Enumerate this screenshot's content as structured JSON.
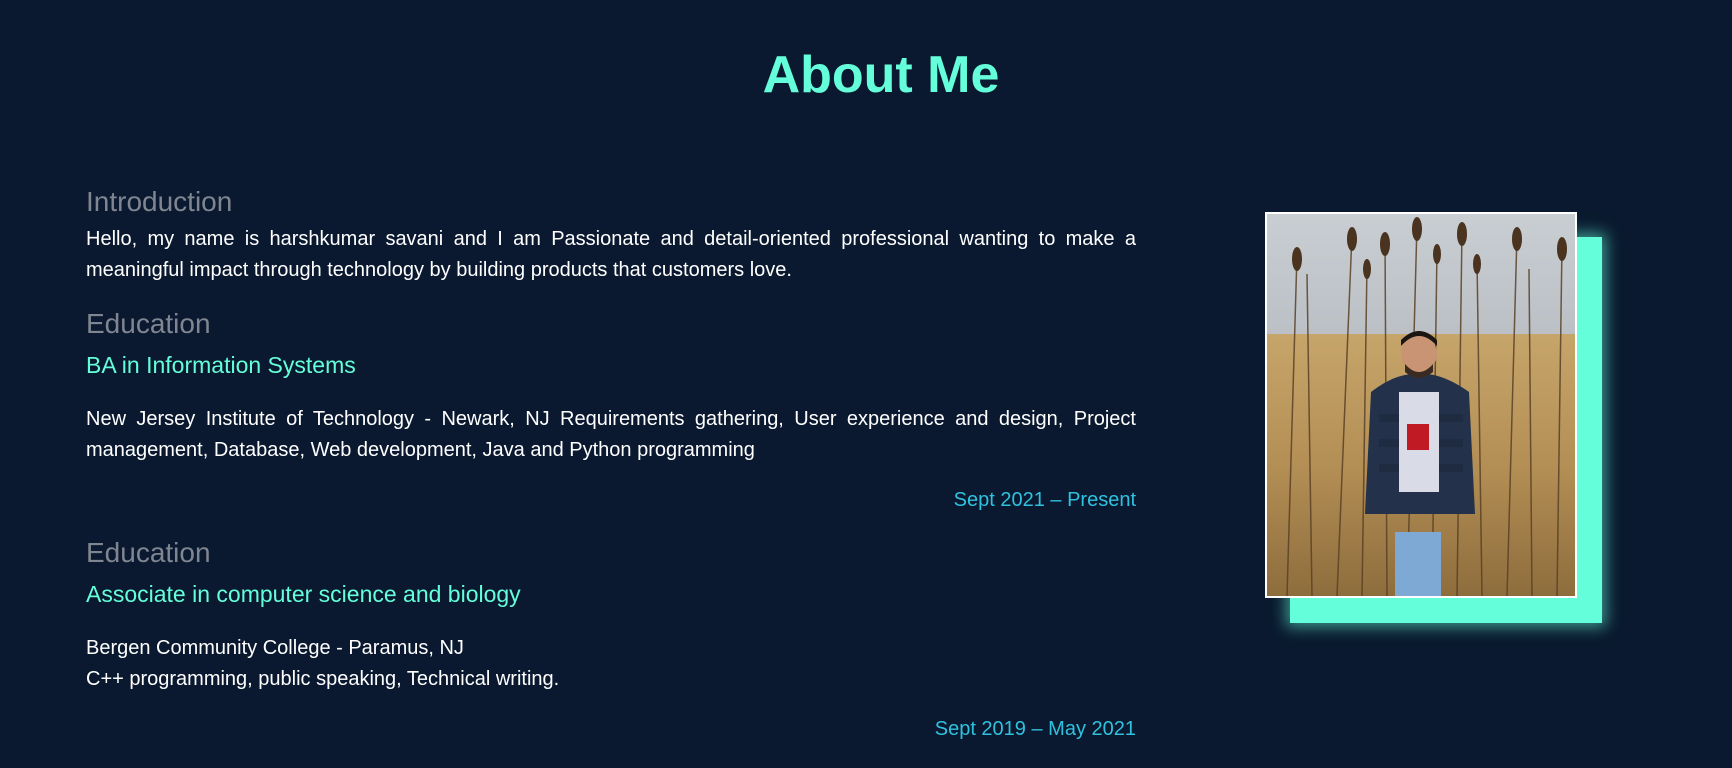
{
  "page": {
    "title": "About Me"
  },
  "introduction": {
    "heading": "Introduction",
    "text": "Hello, my name is harshkumar savani and I am Passionate and detail-oriented professional wanting to make a meaningful impact through technology by building products that customers love."
  },
  "education": [
    {
      "heading": "Education",
      "degree": "BA in Information Systems",
      "details_line1": "New Jersey Institute of Technology - Newark, NJ Requirements gathering, User experience and design, Project management, Database, Web development, Java and Python programming",
      "details_line2": "",
      "dates": "Sept 2021 – Present"
    },
    {
      "heading": "Education",
      "degree": "Associate in computer science and biology",
      "details_line1": "Bergen Community College - Paramus, NJ",
      "details_line2": "C++ programming, public speaking, Technical writing.",
      "dates": "Sept 2019 – May 2021"
    }
  ],
  "colors": {
    "background": "#0a192f",
    "accent": "#64ffda",
    "date": "#2fc2df",
    "muted_heading": "#7f8591"
  },
  "photo": {
    "icon": "profile-photo"
  }
}
